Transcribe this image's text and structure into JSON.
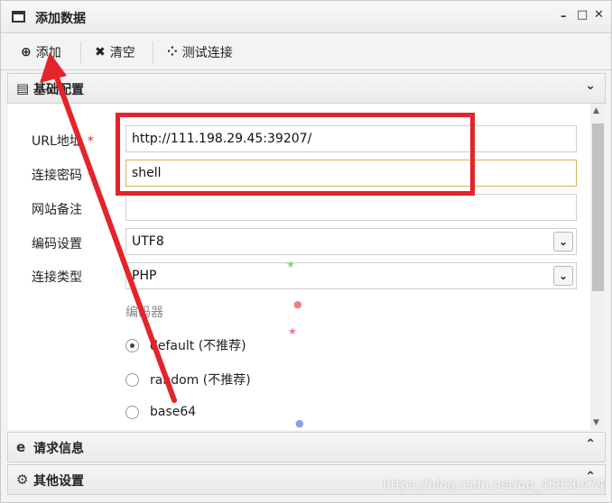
{
  "window": {
    "title": "添加数据",
    "controls": {
      "minimize": "–",
      "maximize": "□",
      "close": "✕"
    }
  },
  "toolbar": {
    "add_label": "添加",
    "clear_label": "清空",
    "test_label": "测试连接"
  },
  "sections": {
    "basic": "基础配置",
    "request": "请求信息",
    "other": "其他设置"
  },
  "form": {
    "url": {
      "label": "URL地址",
      "required": "*",
      "value": "http://111.198.29.45:39207/"
    },
    "password": {
      "label": "连接密码",
      "required": "*",
      "value": "shell"
    },
    "note": {
      "label": "网站备注",
      "value": ""
    },
    "encoding": {
      "label": "编码设置",
      "value": "UTF8"
    },
    "type": {
      "label": "连接类型",
      "value": "PHP"
    },
    "encoder": {
      "title": "编码器",
      "options": [
        {
          "label": "default (不推荐)",
          "selected": true
        },
        {
          "label": "random (不推荐)",
          "selected": false
        },
        {
          "label": "base64",
          "selected": false
        }
      ]
    }
  },
  "watermark": "https://blog.csdn.net/qq_45836474",
  "colors": {
    "annotation": "#e3242b",
    "focus_border": "#d7b25a"
  },
  "icons": [
    "window-icon",
    "plus-circle-icon",
    "times-icon",
    "spinner-icon",
    "file-icon",
    "chevron-down-icon",
    "edge-icon",
    "chevron-up-icon",
    "cogs-icon"
  ]
}
